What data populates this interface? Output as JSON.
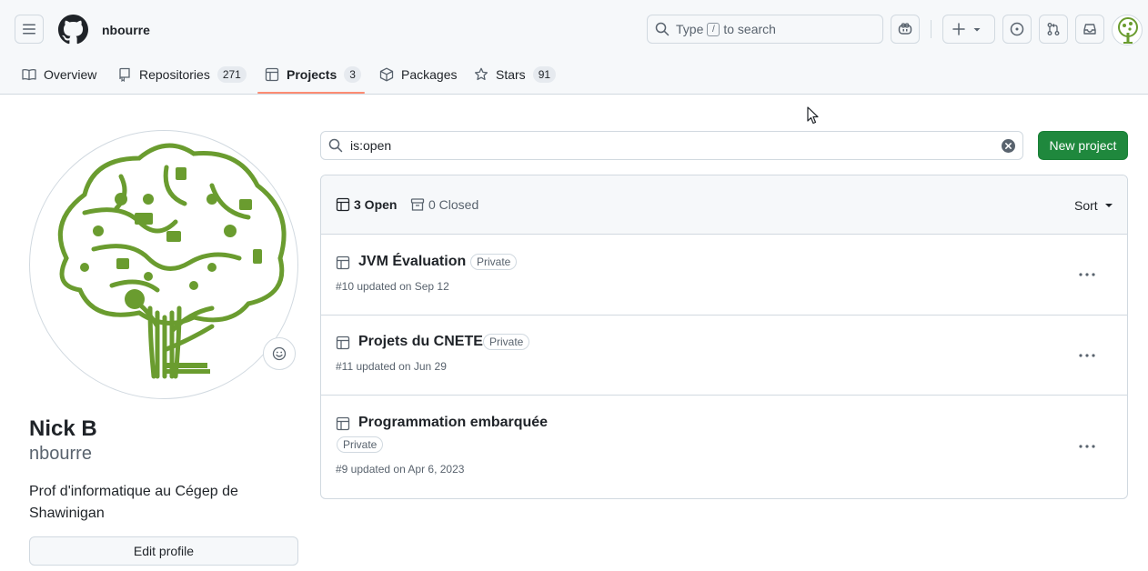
{
  "header": {
    "owner": "nbourre",
    "search": {
      "prefix": "Type",
      "key": "/",
      "suffix": "to search"
    }
  },
  "tabs": [
    {
      "label": "Overview",
      "count": null
    },
    {
      "label": "Repositories",
      "count": "271"
    },
    {
      "label": "Projects",
      "count": "3"
    },
    {
      "label": "Packages",
      "count": null
    },
    {
      "label": "Stars",
      "count": "91"
    }
  ],
  "profile": {
    "name": "Nick B",
    "login": "nbourre",
    "bio": "Prof d'informatique au Cégep de Shawinigan",
    "edit_label": "Edit profile"
  },
  "projects": {
    "filter_value": "is:open",
    "new_label": "New project",
    "open_label": "3 Open",
    "closed_label": "0 Closed",
    "sort_label": "Sort",
    "items": [
      {
        "title": "JVM Évaluation",
        "visibility": "Private",
        "meta": "#10 updated on Sep 12"
      },
      {
        "title": "Projets du CNETE",
        "visibility": "Private",
        "meta": "#11 updated on Jun 29"
      },
      {
        "title": "Programmation embarquée",
        "visibility": "Private",
        "meta": "#9 updated on Apr 6, 2023"
      }
    ]
  },
  "colors": {
    "primary_button": "#1f883d",
    "tab_underline": "#fd8c73",
    "avatar_green": "#6a9c2f"
  }
}
